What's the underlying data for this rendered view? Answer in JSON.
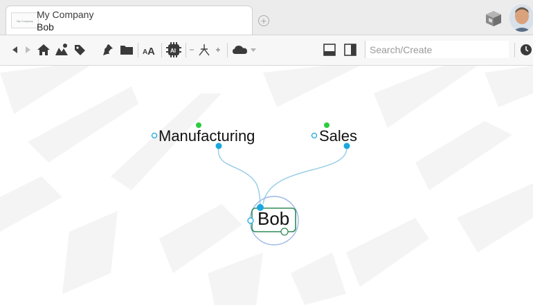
{
  "tab": {
    "title": "My Company",
    "subtitle": "Bob",
    "thumbnail_text": "My Company"
  },
  "toolbar": {
    "search_placeholder": "Search/Create",
    "icons": [
      "back-icon",
      "forward-icon",
      "home-icon",
      "map-icon",
      "tag-icon",
      "pin-icon",
      "folder-icon",
      "font-size-icon",
      "ai-icon",
      "minus-icon",
      "layout-icon",
      "plus-icon",
      "cloud-icon",
      "dropdown-icon",
      "panel-bottom-icon",
      "panel-right-icon",
      "history-icon"
    ]
  },
  "map": {
    "central_node": "Bob",
    "nodes": [
      {
        "label": "Manufacturing"
      },
      {
        "label": "Sales"
      }
    ]
  },
  "colors": {
    "node_border": "#2e8b57",
    "connector": "#9fd1e6",
    "handle_blue": "#1aa7e0",
    "handle_green": "#2ecc40",
    "halo": "#9bb8e8"
  }
}
